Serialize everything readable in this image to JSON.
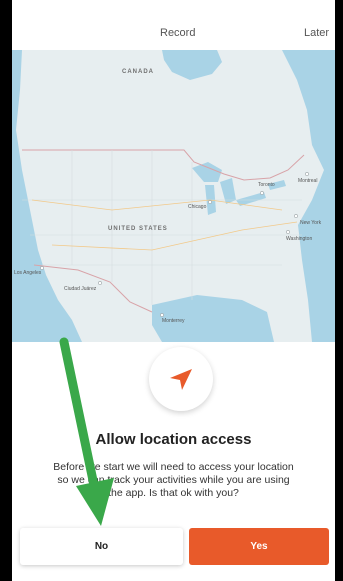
{
  "topbar": {
    "tab_record": "Record",
    "tab_later": "Later"
  },
  "map": {
    "country_canada": "CANADA",
    "country_us": "UNITED STATES",
    "cities": {
      "chicago": "Chicago",
      "toronto": "Toronto",
      "new_york": "New York",
      "washington": "Washington",
      "los_angeles": "Los Angeles",
      "montreal": "Montreal",
      "ciudad_juarez": "Ciudad Juárez",
      "monterrey": "Monterrey"
    }
  },
  "prompt": {
    "icon": "location-arrow-icon",
    "title": "Allow location access",
    "body_lines": [
      "Before we start we will need to access your location",
      "so we can track your activities while you are using",
      "the app. Is that ok with you?"
    ]
  },
  "buttons": {
    "no_label": "No",
    "yes_label": "Yes"
  },
  "overlay": {
    "annotation": "green-arrow-icon"
  },
  "colors": {
    "accent": "#e85a2a",
    "annotation_green": "#3aa84a",
    "water": "#a9d3e6",
    "land": "#e7eef0"
  }
}
